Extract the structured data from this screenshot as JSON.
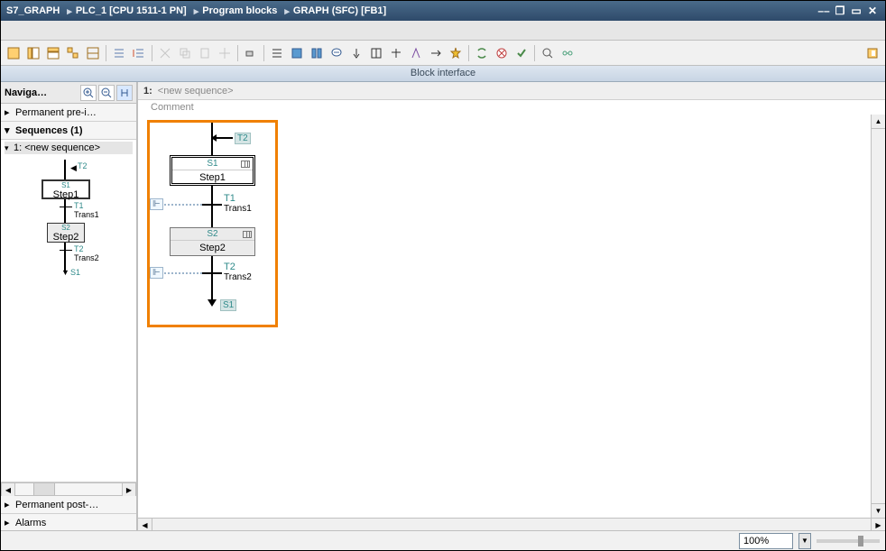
{
  "titlebar": {
    "crumbs": [
      "S7_GRAPH",
      "PLC_1 [CPU 1511-1 PN]",
      "Program blocks",
      "GRAPH (SFC) [FB1]"
    ]
  },
  "block_interface_label": "Block interface",
  "nav": {
    "title": "Naviga…",
    "rows": {
      "pre": "Permanent pre-i…",
      "seq": "Sequences (1)",
      "post": "Permanent post-…",
      "alarms": "Alarms"
    },
    "tree_item": "1: <new sequence>",
    "mini": {
      "t2": "T2",
      "s1": "S1",
      "step1": "Step1",
      "t1": "T1",
      "trans1": "Trans1",
      "s2": "S2",
      "step2": "Step2",
      "t2b": "T2",
      "trans2": "Trans2",
      "s1b": "S1"
    }
  },
  "canvas": {
    "seq_num": "1:",
    "seq_name": "<new sequence>",
    "comment": "Comment",
    "diag": {
      "entry_jump": "T2",
      "s1": "S1",
      "step1": "Step1",
      "t1": "T1",
      "trans1": "Trans1",
      "s2": "S2",
      "step2": "Step2",
      "t2": "T2",
      "trans2": "Trans2",
      "exit_jump": "S1"
    }
  },
  "status": {
    "zoom": "100%"
  }
}
